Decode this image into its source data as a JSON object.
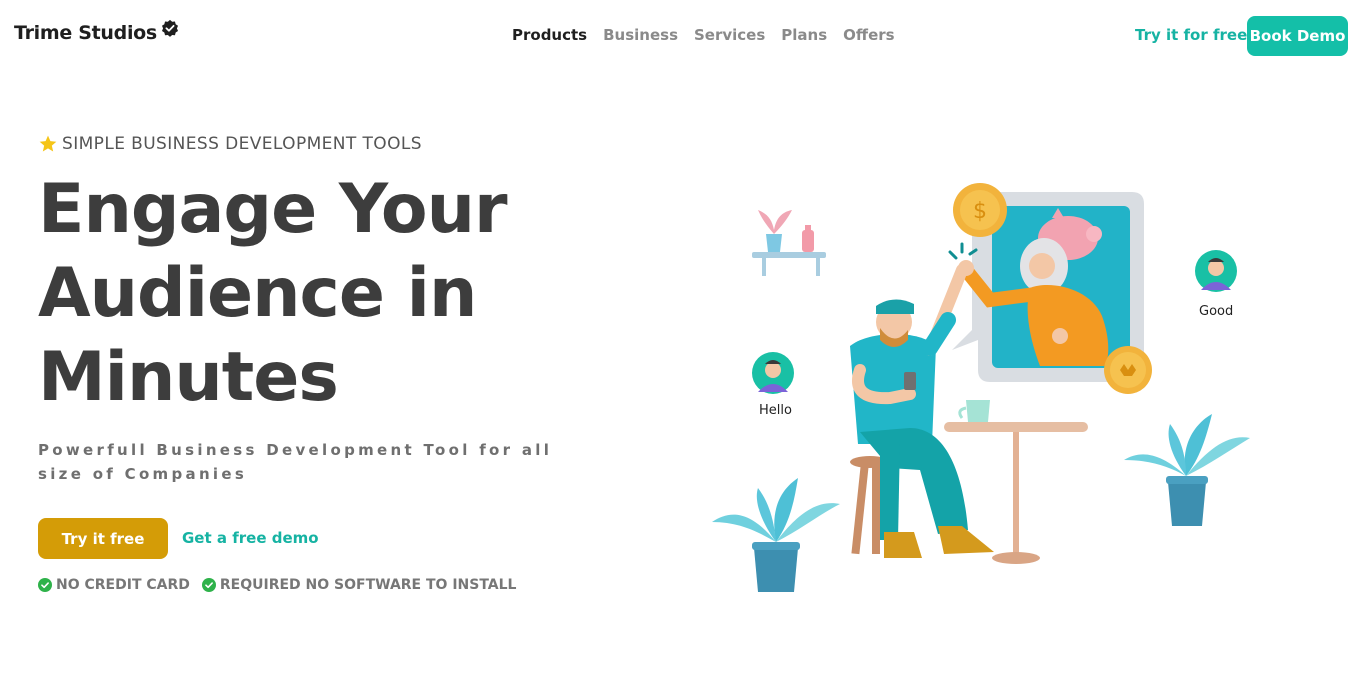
{
  "brand": {
    "name": "Trime Studios",
    "icon": "verified-badge-icon"
  },
  "nav": {
    "items": [
      {
        "label": "Products",
        "active": true
      },
      {
        "label": "Business",
        "active": false
      },
      {
        "label": "Services",
        "active": false
      },
      {
        "label": "Plans",
        "active": false
      },
      {
        "label": "Offers",
        "active": false
      }
    ],
    "try_label": "Try it for free",
    "demo_label": "Book Demo"
  },
  "hero": {
    "eyebrow": "SIMPLE BUSINESS DEVELOPMENT TOOLS",
    "headline": [
      "Engage Your",
      "Audience in",
      "Minutes"
    ],
    "subtitle": "Powerfull Business Development Tool for all size of Companies",
    "primary_cta": "Try it free",
    "secondary_cta": "Get a free demo",
    "checks": [
      "NO CREDIT CARD",
      "REQUIRED NO SOFTWARE TO INSTALL"
    ]
  },
  "illustration": {
    "bubble_left": "Hello",
    "bubble_right": "Good"
  },
  "colors": {
    "accent": "#14bfa8",
    "primary_button": "#d49c07",
    "check": "#2eb24a",
    "star": "#f5c518"
  }
}
